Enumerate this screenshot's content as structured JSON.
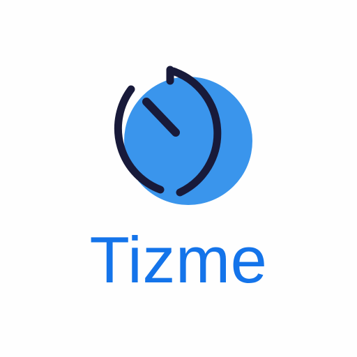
{
  "app": {
    "name": "Tizme",
    "logo_icon": "stopwatch-icon"
  },
  "colors": {
    "background": "#fefefe",
    "accent_blue": "#3a95ec",
    "wordmark_blue": "#1474ea",
    "stroke_navy": "#181a3a"
  }
}
